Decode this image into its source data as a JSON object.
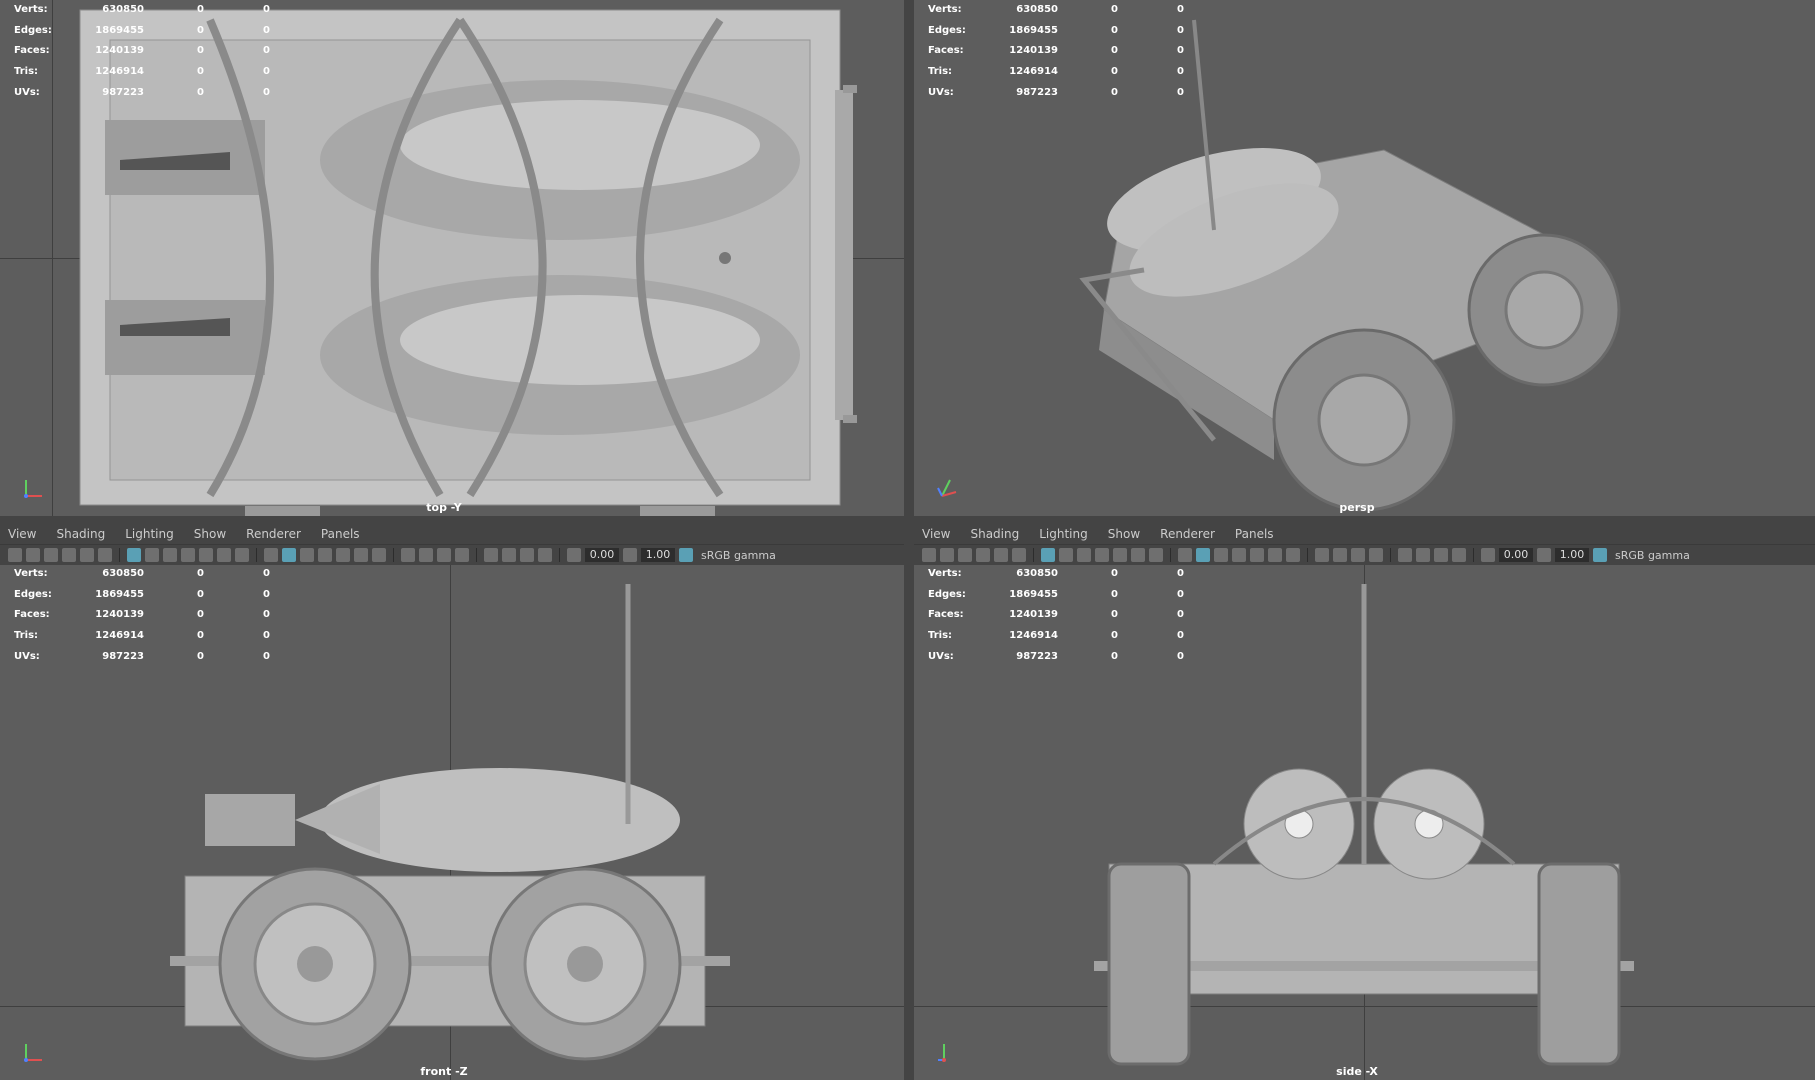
{
  "menus": [
    "View",
    "Shading",
    "Lighting",
    "Show",
    "Renderer",
    "Panels"
  ],
  "toolbar": {
    "field1": "0.00",
    "field2": "1.00",
    "color_mgmt": "sRGB gamma"
  },
  "stats": [
    {
      "label": "Verts:",
      "v1": "630850",
      "v2": "0",
      "v3": "0"
    },
    {
      "label": "Edges:",
      "v1": "1869455",
      "v2": "0",
      "v3": "0"
    },
    {
      "label": "Faces:",
      "v1": "1240139",
      "v2": "0",
      "v3": "0"
    },
    {
      "label": "Tris:",
      "v1": "1246914",
      "v2": "0",
      "v3": "0"
    },
    {
      "label": "UVs:",
      "v1": "987223",
      "v2": "0",
      "v3": "0"
    }
  ],
  "viewports": {
    "top": {
      "camera": "top -Y"
    },
    "persp": {
      "camera": "persp"
    },
    "front": {
      "camera": "front -Z"
    },
    "side": {
      "camera": "side -X"
    }
  },
  "colors": {
    "bg": "#5d5d5d",
    "menubar": "#444444",
    "model": "#b5b5b5",
    "accent": "#5aa0b5"
  }
}
